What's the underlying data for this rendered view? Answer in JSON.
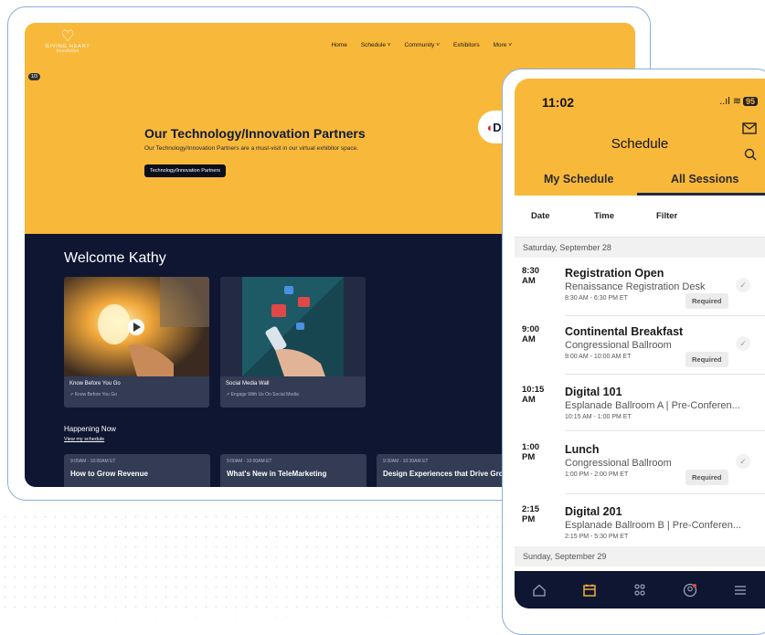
{
  "desktop": {
    "logo": {
      "mark": "♡",
      "name": "GIVING HEART",
      "sub": "foundation"
    },
    "nav": [
      "Home",
      "Schedule ˅",
      "Community ˅",
      "Exhibitors",
      "More ˅"
    ],
    "slide_badge": "1/3",
    "hero": {
      "title": "Our Technology/Innovation Partners",
      "description": "Our Technology/Innovation Partners are a must-visit in our virtual exhibitor space.",
      "button": "Technology/Innovation Partners",
      "partner_logo": "DIGIX"
    },
    "welcome": "Welcome Kathy",
    "cards": [
      {
        "title": "Know Before You Go",
        "subtitle": "↗ Know Before You Go"
      },
      {
        "title": "Social Media Wall",
        "subtitle": "↗ Engage With Us On Social Media"
      }
    ],
    "happening": {
      "heading": "Happening Now",
      "link": "View my schedule"
    },
    "sessions": [
      {
        "time": "9:00AM - 10:00AM ET",
        "title": "How to Grow Revenue"
      },
      {
        "time": "9:00AM - 10:00AM ET",
        "title": "What's New in TeleMarketing"
      },
      {
        "time": "9:30AM - 10:30AM ET",
        "title": "Design Experiences that Drive Growth"
      }
    ]
  },
  "phone": {
    "status_time": "11:02",
    "signal": "..ıl ≋",
    "battery": "95",
    "title": "Schedule",
    "tabs": [
      "My Schedule",
      "All Sessions"
    ],
    "active_tab": "All Sessions",
    "filters": [
      "Date",
      "Time",
      "Filter"
    ],
    "day1": "Saturday, September 28",
    "day2": "Sunday, September 29",
    "events": [
      {
        "time": "8:30 AM",
        "title": "Registration Open",
        "location": "Renaissance Registration Desk",
        "range": "8:30 AM - 6:30 PM ET",
        "badge": "Required",
        "check": "✓"
      },
      {
        "time": "9:00 AM",
        "title": "Continental Breakfast",
        "location": "Congressional Ballroom",
        "range": "9:00 AM - 10:00 AM ET",
        "badge": "Required",
        "check": "✓"
      },
      {
        "time": "10:15 AM",
        "title": "Digital 101",
        "location": "Esplanade Ballroom A | Pre-Conferen...",
        "range": "10:15 AM - 1:00 PM ET"
      },
      {
        "time": "1:00 PM",
        "title": "Lunch",
        "location": "Congressional Ballroom",
        "range": "1:00 PM - 2:00 PM ET",
        "badge": "Required",
        "check": "✓"
      },
      {
        "time": "2:15 PM",
        "title": "Digital 201",
        "location": "Esplanade Ballroom B | Pre-Conferen...",
        "range": "2:15 PM - 5:30 PM ET"
      }
    ],
    "tabbar_icons": [
      "home-icon",
      "calendar-icon",
      "people-icon",
      "profile-icon",
      "menu-icon"
    ],
    "colors": {
      "brand": "#f8b83a",
      "navy": "#0f1632",
      "active_icon": "#f8b83a"
    }
  }
}
